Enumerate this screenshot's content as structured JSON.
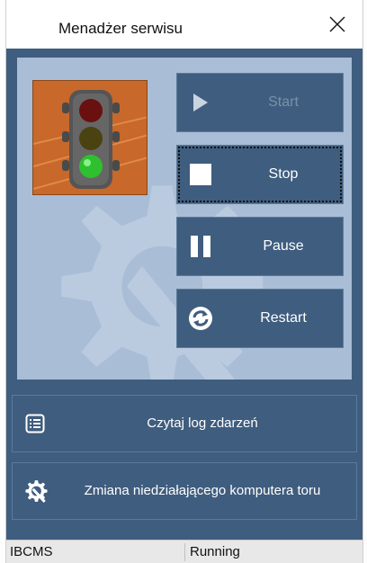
{
  "window": {
    "title": "Menadżer serwisu"
  },
  "status_icon": "traffic-light-green",
  "controls": {
    "start": {
      "label": "Start",
      "icon": "play-icon",
      "enabled": false
    },
    "stop": {
      "label": "Stop",
      "icon": "stop-icon",
      "enabled": true
    },
    "pause": {
      "label": "Pause",
      "icon": "pause-icon",
      "enabled": true
    },
    "restart": {
      "label": "Restart",
      "icon": "refresh-icon",
      "enabled": true
    }
  },
  "actions": {
    "read_log": {
      "label": "Czytaj log zdarzeń",
      "icon": "list-icon"
    },
    "change_computer": {
      "label": "Zmiana niedziałającego komputera toru",
      "icon": "gear-wrench-icon"
    }
  },
  "statusbar": {
    "service": "IBCMS",
    "state": "Running"
  },
  "colors": {
    "panel_dark": "#3f5d7e",
    "panel_light": "#a9bdd6",
    "disabled_text": "#7a91ab",
    "traffic_bg": "#c8682a"
  }
}
